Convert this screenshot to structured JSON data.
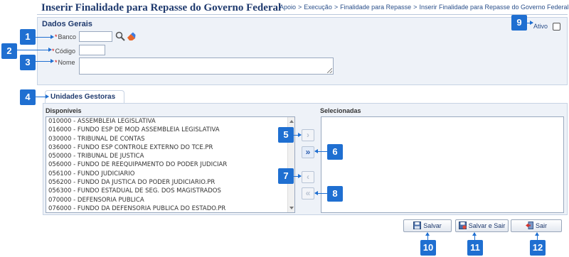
{
  "page": {
    "title": "Inserir Finalidade para Repasse do Governo Federal",
    "breadcrumb": [
      "Apoio",
      ">",
      "Execução",
      ">",
      "Finalidade para Repasse",
      ">",
      "Inserir Finalidade para Repasse do Governo Federal"
    ]
  },
  "dados_gerais": {
    "title": "Dados Gerais",
    "banco_label": "Banco",
    "codigo_label": "Código",
    "nome_label": "Nome",
    "required_mark": "*",
    "ativo_label": "Ativo",
    "ativo_checked": false,
    "banco_value": "",
    "codigo_value": "",
    "nome_value": ""
  },
  "unidades": {
    "tab_label": "Unidades Gestoras",
    "disponiveis_label": "Disponíveis",
    "selecionadas_label": "Selecionadas",
    "disponiveis": [
      "010000 - ASSEMBLEIA LEGISLATIVA",
      "016000 - FUNDO ESP DE MOD ASSEMBLEIA LEGISLATIVA",
      "030000 - TRIBUNAL DE CONTAS",
      "036000 - FUNDO ESP CONTROLE EXTERNO DO TCE.PR",
      "050000 - TRIBUNAL DE JUSTICA",
      "056000 - FUNDO DE REEQUIPAMENTO DO PODER JUDICIAR",
      "056100 - FUNDO JUDICIARIO",
      "056200 - FUNDO DA JUSTICA DO PODER JUDICIARIO.PR",
      "056300 - FUNDO ESTADUAL DE SEG. DOS MAGISTRADOS",
      "070000 - DEFENSORIA PUBLICA",
      "076000 - FUNDO DA DEFENSORIA PUBLICA DO ESTADO.PR"
    ],
    "selecionadas": [],
    "move_buttons": {
      "add_one": "›",
      "add_all": "»",
      "remove_one": "‹",
      "remove_all": "«"
    }
  },
  "actions": {
    "salvar": "Salvar",
    "salvar_e_sair": "Salvar e Sair",
    "sair": "Sair"
  },
  "markers": [
    "1",
    "2",
    "3",
    "4",
    "5",
    "6",
    "7",
    "8",
    "9",
    "10",
    "11",
    "12"
  ],
  "colors": {
    "marker": "#1f6fd1",
    "title": "#1f3a6e",
    "panel": "#eef2f8",
    "required": "#cc0000"
  }
}
